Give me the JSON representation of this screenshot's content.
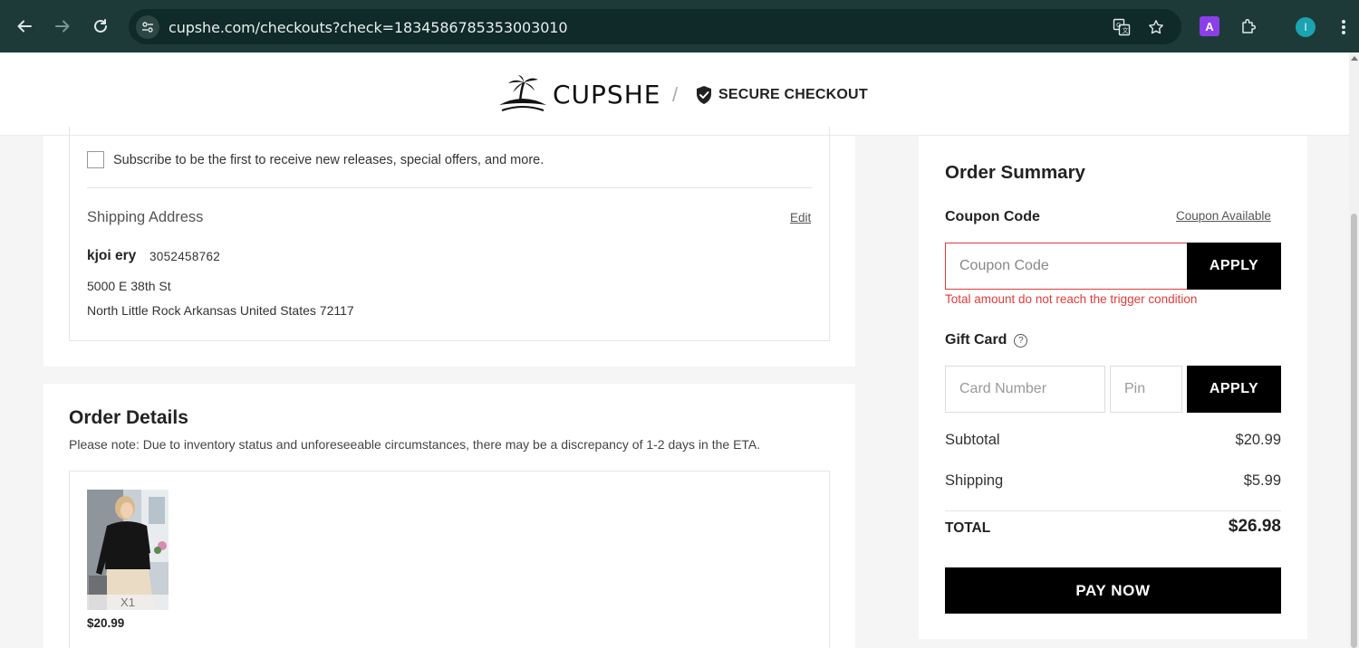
{
  "browser": {
    "url": "cupshe.com/checkouts?check=1834586785353003010",
    "extension_letter": "A",
    "profile_initial": "I"
  },
  "header": {
    "brand": "CUPSHE",
    "separator": "/",
    "secure_label": "SECURE CHECKOUT"
  },
  "contact": {
    "subscribe_text": "Subscribe to be the first to receive new releases, special offers, and more."
  },
  "shipping": {
    "title": "Shipping Address",
    "edit_label": "Edit",
    "name": "kjoi ery",
    "phone": "3052458762",
    "line1": "5000 E 38th St",
    "line2": "North Little Rock Arkansas United States 72117"
  },
  "order_details": {
    "title": "Order Details",
    "note": "Please note: Due to inventory status and unforeseeable circumstances, there may be a discrepancy of 1-2 days in the ETA.",
    "items": [
      {
        "quantity": "X1",
        "price": "$20.99"
      }
    ]
  },
  "summary": {
    "title": "Order Summary",
    "coupon_label": "Coupon Code",
    "coupon_available": "Coupon Available",
    "coupon_placeholder": "Coupon Code",
    "apply_label": "APPLY",
    "coupon_error": "Total amount do not reach the trigger condition",
    "gift_label": "Gift Card",
    "card_placeholder": "Card Number",
    "pin_placeholder": "Pin",
    "subtotal_label": "Subtotal",
    "subtotal_value": "$20.99",
    "shipping_label": "Shipping",
    "shipping_value": "$5.99",
    "total_label": "TOTAL",
    "total_value": "$26.98",
    "pay_label": "PAY NOW"
  },
  "colors": {
    "chrome_bg": "#1e3a38",
    "error": "#e03a3a",
    "button": "#000000"
  }
}
